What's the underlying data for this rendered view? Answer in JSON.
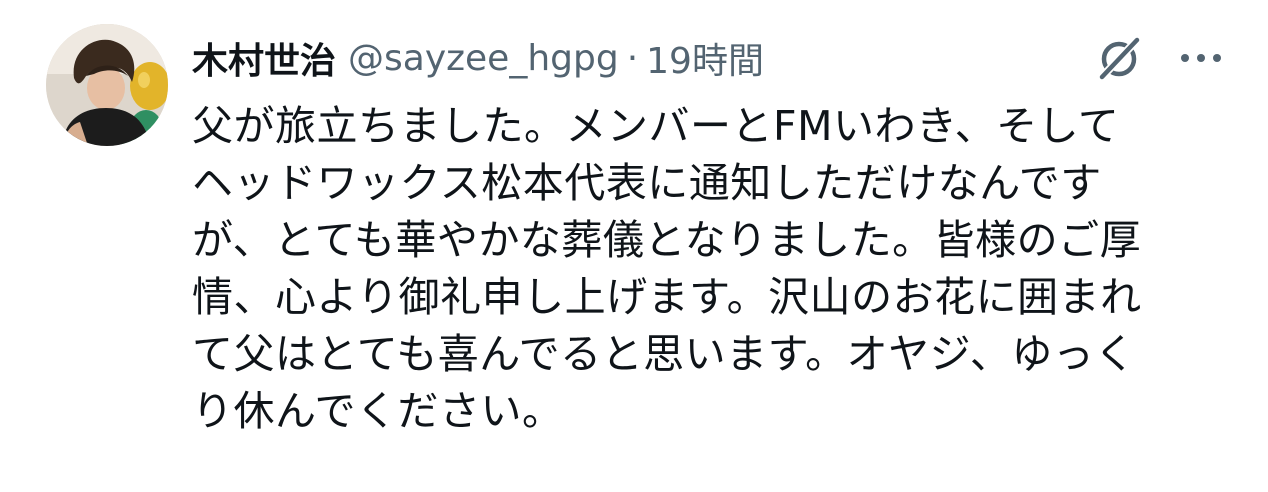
{
  "author": {
    "display_name": "木村世治",
    "handle": "@sayzee_hgpg",
    "separator": "·",
    "timestamp": "19時間"
  },
  "icons": {
    "avatar": "user-avatar-photo",
    "grok": "grok-icon",
    "more": "more-dots-icon"
  },
  "colors": {
    "text_primary": "#0f1419",
    "text_secondary": "#536471"
  },
  "tweet": {
    "text": "父が旅立ちました。メンバーとFMいわき、そして\nヘッドワックス松本代表に通知しただけなんです\nが、とても華やかな葬儀となりました。皆様のご厚\n情、心より御礼申し上げます。沢山のお花に囲まれ\nて父はとても喜んでると思います。オヤジ、ゆっく\nり休んでください。"
  }
}
